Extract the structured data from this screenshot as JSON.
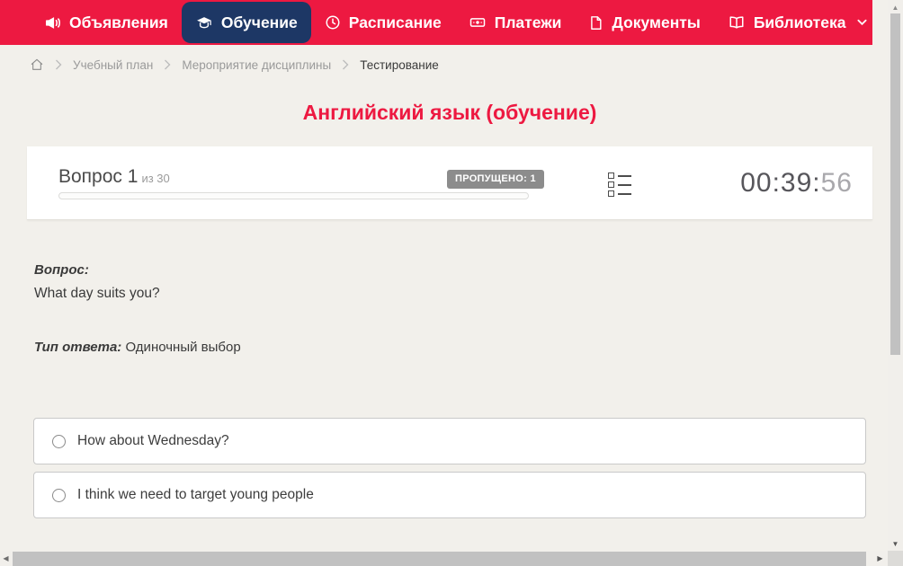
{
  "colors": {
    "accent_red": "#ed1941",
    "active_navy": "#1d3765",
    "badge_gray": "#8c8c8c"
  },
  "nav": {
    "items": [
      {
        "label": "Объявления",
        "icon": "megaphone-icon",
        "active": false
      },
      {
        "label": "Обучение",
        "icon": "graduation-cap-icon",
        "active": true
      },
      {
        "label": "Расписание",
        "icon": "clock-icon",
        "active": false
      },
      {
        "label": "Платежи",
        "icon": "banknote-icon",
        "active": false
      },
      {
        "label": "Документы",
        "icon": "document-icon",
        "active": false
      },
      {
        "label": "Библиотека",
        "icon": "book-icon",
        "active": false,
        "has_dropdown": true
      }
    ]
  },
  "breadcrumb": {
    "items": [
      "Учебный план",
      "Мероприятие дисциплины",
      "Тестирование"
    ]
  },
  "page": {
    "title": "Английский язык (обучение)"
  },
  "quiz": {
    "question_label": "Вопрос 1",
    "question_total": "из 30",
    "skipped_badge": "ПРОПУЩЕНО: 1",
    "timer": {
      "main": "00:39:",
      "seconds": "56"
    },
    "question_heading": "Вопрос:",
    "question_text": "What day suits you?",
    "answer_type_label": "Тип ответа:",
    "answer_type_value": "Одиночный выбор",
    "options": [
      "How about Wednesday?",
      "I think we need to target young people"
    ]
  }
}
